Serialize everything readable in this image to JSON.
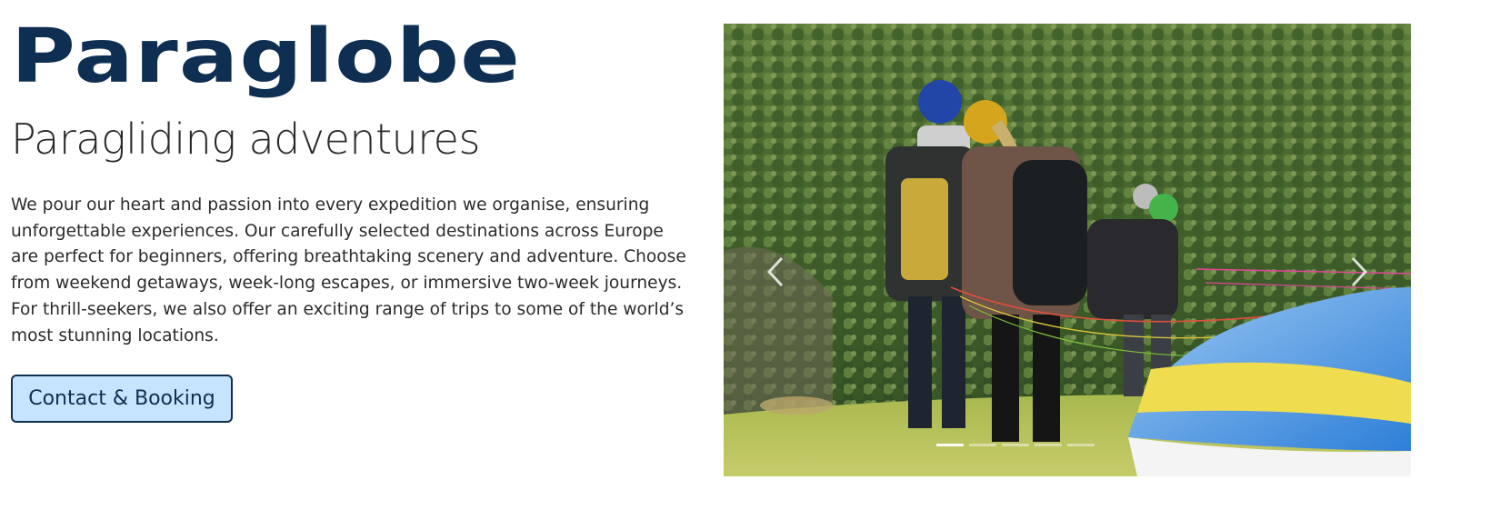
{
  "hero": {
    "brand": "Paraglobe",
    "tagline": "Paragliding adventures",
    "intro": "We pour our heart and passion into every expedition we organise, ensuring unforgettable experiences. Our carefully selected destinations across Europe are perfect for beginners, offering breathtaking scenery and adventure. Choose from weekend getaways, week-long escapes, or immersive two-week journeys. For thrill-seekers, we also offer an exciting range of trips to some of the world’s most stunning locations.",
    "cta_label": "Contact & Booking"
  },
  "carousel": {
    "prev_icon": "chevron-left-icon",
    "next_icon": "chevron-right-icon",
    "slide_count": 5,
    "active_slide": 1
  },
  "colors": {
    "brand": "#0f2f52",
    "cta_background": "#c7e4ff"
  }
}
